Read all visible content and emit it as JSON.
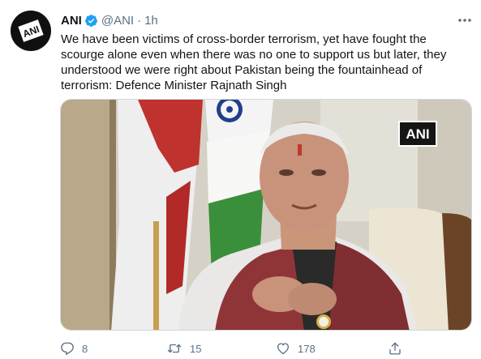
{
  "tweet": {
    "display_name": "ANI",
    "handle": "@ANI",
    "separator": "·",
    "time": "1h",
    "text": "We have been victims of cross-border terrorism, yet have fought the scourge alone even when there was no one to support us but later, they understood we were right about Pakistan being the fountainhead of terrorism: Defence Minister Rajnath Singh",
    "media": {
      "watermark": "ANI"
    },
    "actions": {
      "reply_count": "8",
      "retweet_count": "15",
      "like_count": "178"
    }
  },
  "colors": {
    "verified_badge": "#1da1f2",
    "secondary_text": "#5b7083",
    "primary_text": "#0f1419"
  },
  "icons": {
    "avatar": "ani-logo-icon",
    "verified": "verified-badge-icon",
    "more": "more-dots-icon",
    "reply": "reply-icon",
    "retweet": "retweet-icon",
    "like": "heart-icon",
    "share": "share-icon"
  }
}
